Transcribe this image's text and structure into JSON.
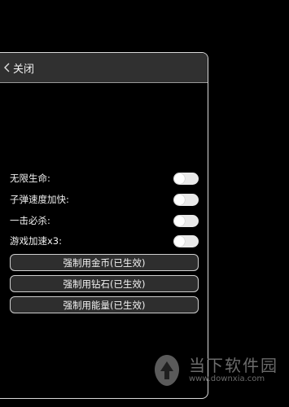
{
  "header": {
    "back_label": "关闭"
  },
  "toggles": [
    {
      "label": "无限生命:",
      "on": false
    },
    {
      "label": "子弹速度加快:",
      "on": false
    },
    {
      "label": "一击必杀:",
      "on": false
    },
    {
      "label": "游戏加速x3:",
      "on": false
    }
  ],
  "buttons": [
    {
      "label": "强制用金币(已生效)"
    },
    {
      "label": "强制用钻石(已生效)"
    },
    {
      "label": "强制用能量(已生效)"
    }
  ],
  "watermark": {
    "title": "当下软件园",
    "url": "www.downxia.com"
  },
  "colors": {
    "background": "#000000",
    "header": "#303030",
    "button": "#2e2e2e",
    "toggle_off": "#e9e9e9"
  }
}
